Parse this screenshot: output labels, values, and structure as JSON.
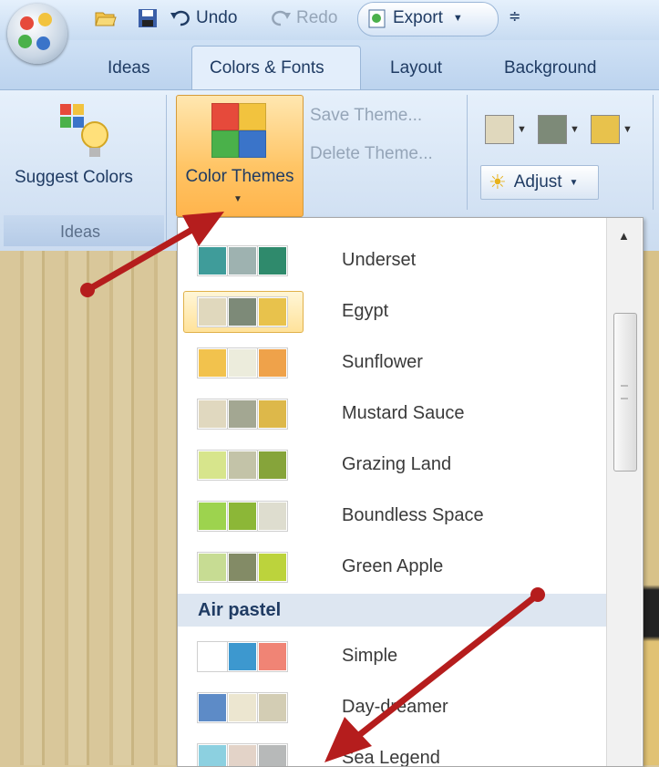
{
  "quick_access": {
    "undo_label": "Undo",
    "redo_label": "Redo",
    "export_label": "Export"
  },
  "tabs": [
    "Ideas",
    "Colors & Fonts",
    "Layout",
    "Background"
  ],
  "ribbon": {
    "suggest_colors_label": "Suggest Colors",
    "ideas_group_label": "Ideas",
    "color_themes_label": "Color Themes",
    "save_theme_label": "Save Theme...",
    "delete_theme_label": "Delete Theme...",
    "adjust_label": "Adjust",
    "current_swatches": [
      "#e0d8bd",
      "#7d8a78",
      "#e8c24c"
    ]
  },
  "themes": [
    {
      "name": "Underset",
      "colors": [
        "#3f9c9a",
        "#9eb2b0",
        "#2f8a6c"
      ]
    },
    {
      "name": "Egypt",
      "colors": [
        "#e0d8bd",
        "#7d8a78",
        "#e8c24c"
      ],
      "selected": true
    },
    {
      "name": "Sunflower",
      "colors": [
        "#f2c24d",
        "#ececdc",
        "#efa24a"
      ]
    },
    {
      "name": "Mustard Sauce",
      "colors": [
        "#e0d8bf",
        "#a3a792",
        "#ddb84a"
      ]
    },
    {
      "name": "Grazing Land",
      "colors": [
        "#d7e58c",
        "#c3c3a8",
        "#86a43a"
      ]
    },
    {
      "name": "Boundless Space",
      "colors": [
        "#9dd34e",
        "#8cb737",
        "#deddcf"
      ]
    },
    {
      "name": "Green Apple",
      "colors": [
        "#c7dc93",
        "#838b66",
        "#bcd33c"
      ]
    }
  ],
  "category_header": "Air pastel",
  "themes_after": [
    {
      "name": "Simple",
      "colors": [
        "#ffffff",
        "#3d98cf",
        "#f08475"
      ]
    },
    {
      "name": "Day-dreamer",
      "colors": [
        "#5d8bc7",
        "#ece6d0",
        "#d3cdb4"
      ]
    },
    {
      "name": "Sea Legend",
      "colors": [
        "#8cd0e0",
        "#e3d3c8",
        "#b7b9b9"
      ]
    }
  ],
  "accent_colors": {
    "ribbon_active": "#ffc464",
    "annotation_arrow": "#b51d1d"
  }
}
